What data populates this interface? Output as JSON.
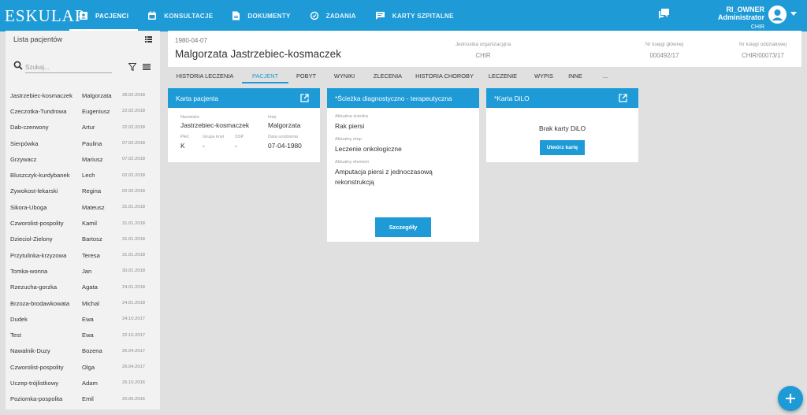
{
  "app": {
    "logo": "ESKULAP"
  },
  "nav": [
    {
      "label": "PACJENCI",
      "icon": "patients-icon",
      "active": true
    },
    {
      "label": "KONSULTACJE",
      "icon": "calendar-icon"
    },
    {
      "label": "DOKUMENTY",
      "icon": "document-icon"
    },
    {
      "label": "ZADANIA",
      "icon": "tasks-icon"
    },
    {
      "label": "KARTY SZPITALNE",
      "icon": "chat-cards-icon"
    }
  ],
  "user": {
    "name": "RI_OWNER Administrator",
    "unit": "CHIR"
  },
  "sidebar": {
    "title": "Lista pacjentów",
    "search_placeholder": "Szukaj...",
    "patients": [
      {
        "last": "Jastrzebiec-kosmaczek",
        "first": "Malgorzata",
        "date": "28.02.2018"
      },
      {
        "last": "Czeczotka-Tundrowa",
        "first": "Eugeniusz",
        "date": "22.02.2018"
      },
      {
        "last": "Dab-czerwony",
        "first": "Artur",
        "date": "22.02.2018"
      },
      {
        "last": "Sierpówka",
        "first": "Paulina",
        "date": "07.02.2018"
      },
      {
        "last": "Grzywacz",
        "first": "Mariusz",
        "date": "07.02.2018"
      },
      {
        "last": "Bluszczyk-kurdybanek",
        "first": "Lech",
        "date": "02.02.2018"
      },
      {
        "last": "Zywokost-lekarski",
        "first": "Regina",
        "date": "02.02.2018"
      },
      {
        "last": "Sikora-Uboga",
        "first": "Mateusz",
        "date": "31.01.2018"
      },
      {
        "last": "Czworolist-pospolity",
        "first": "Kamil",
        "date": "31.01.2018"
      },
      {
        "last": "Dzieciol-Zielony",
        "first": "Bartosz",
        "date": "31.01.2018"
      },
      {
        "last": "Przytulinka-krzyzowa",
        "first": "Teresa",
        "date": "31.01.2018"
      },
      {
        "last": "Tomka-wonna",
        "first": "Jan",
        "date": "30.01.2018"
      },
      {
        "last": "Rzezucha-gorzka",
        "first": "Agata",
        "date": "24.01.2018"
      },
      {
        "last": "Brzoza-brodawkowata",
        "first": "Michal",
        "date": "24.01.2018"
      },
      {
        "last": "Dudek",
        "first": "Ewa",
        "date": "24.10.2017"
      },
      {
        "last": "Test",
        "first": "Ewa",
        "date": "22.10.2017"
      },
      {
        "last": "Nawalnik-Duzy",
        "first": "Bozena",
        "date": "26.04.2017"
      },
      {
        "last": "Czworolist-pospolity",
        "first": "Olga",
        "date": "26.04.2017"
      },
      {
        "last": "Uczep-trójlistkowy",
        "first": "Adam",
        "date": "26.10.2016"
      },
      {
        "last": "Poziomka-pospolita",
        "first": "Emil",
        "date": "20.06.2016"
      }
    ]
  },
  "patient": {
    "birth_date": "1980-04-07",
    "full_name": "Malgorzata Jastrzebiec-kosmaczek",
    "unit_label": "Jednostka organizacyjna",
    "unit_value": "CHIR",
    "main_book_label": "Nr księgi głównej",
    "main_book_value": "000492/17",
    "dept_book_label": "Nr księgi oddziałowej",
    "dept_book_value": "CHIR/00073/17"
  },
  "tabs": [
    {
      "label": "HISTORIA LECZENIA"
    },
    {
      "label": "PACJENT",
      "active": true
    },
    {
      "label": "POBYT"
    },
    {
      "label": "WYNIKI"
    },
    {
      "label": "ZLECENIA"
    },
    {
      "label": "HISTORIA CHOROBY"
    },
    {
      "label": "LECZENIE"
    },
    {
      "label": "WYPIS"
    },
    {
      "label": "INNE"
    },
    {
      "label": "..."
    }
  ],
  "card_patient": {
    "title": "Karta pacjenta",
    "surname_label": "Nazwisko",
    "surname_value": "Jastrzebiec-kosmaczek",
    "name_label": "Imię",
    "name_value": "Malgorzata",
    "sex_label": "Płeć",
    "sex_value": "K",
    "blood_label": "Grupa krwi",
    "blood_value": "-",
    "ssp_label": "SSP",
    "ssp_value": "-",
    "birth_label": "Data urodzenia",
    "birth_value": "07-04-1980"
  },
  "card_path": {
    "title": "*Ścieżka diagnostyczno - terapeutyczna",
    "path_label": "Aktualna ścieżka",
    "path_value": "Rak piersi",
    "stage_label": "Aktualny etap",
    "stage_value": "Leczenie onkologiczne",
    "element_label": "Aktualny element",
    "element_value": "Amputacja piersi z jednoczasową rekonstrukcją",
    "details_button": "Szczegóły"
  },
  "card_dilo": {
    "title": "*Karta DiLO",
    "empty_text": "Brak karty DiLO",
    "create_button": "Utwórz kartę"
  },
  "colors": {
    "primary": "#1e9bd7",
    "background": "#e0e0e0"
  }
}
